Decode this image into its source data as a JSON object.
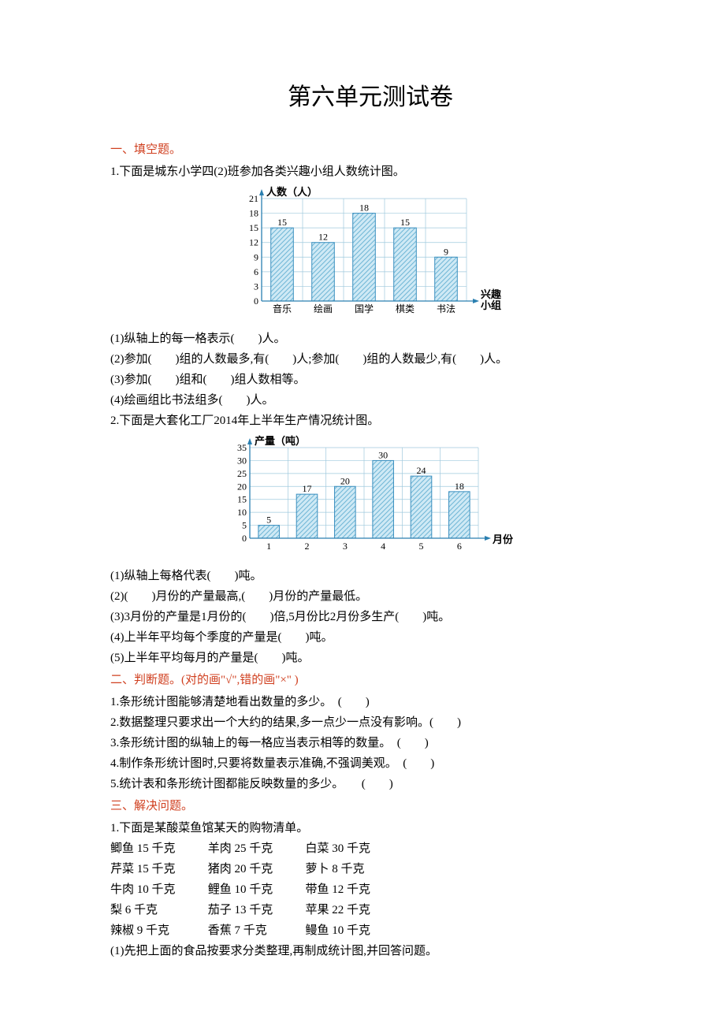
{
  "title": "第六单元测试卷",
  "sec1": {
    "head": "一、填空题。",
    "q1_intro": "1.下面是城东小学四(2)班参加各类兴趣小组人数统计图。",
    "q1_1": "(1)纵轴上的每一格表示(　　)人。",
    "q1_2": "(2)参加(　　)组的人数最多,有(　　)人;参加(　　)组的人数最少,有(　　)人。",
    "q1_3": "(3)参加(　　)组和(　　)组人数相等。",
    "q1_4": "(4)绘画组比书法组多(　　)人。",
    "q2_intro": "2.下面是大套化工厂2014年上半年生产情况统计图。",
    "q2_1": "(1)纵轴上每格代表(　　)吨。",
    "q2_2": "(2)(　　)月份的产量最高,(　　)月份的产量最低。",
    "q2_3": "(3)3月份的产量是1月份的(　　)倍,5月份比2月份多生产(　　)吨。",
    "q2_4": "(4)上半年平均每个季度的产量是(　　)吨。",
    "q2_5": "(5)上半年平均每月的产量是(　　)吨。"
  },
  "sec2": {
    "head": "二、判断题。(对的画\"√\",错的画\"×\" )",
    "j1": "1.条形统计图能够清楚地看出数量的多少。　(　　)",
    "j2": "2.数据整理只要求出一个大约的结果,多一点少一点没有影响。(　　)",
    "j3": "3.条形统计图的纵轴上的每一格应当表示相等的数量。　(　　)",
    "j4": "4.制作条形统计图时,只要将数量表示准确,不强调美观。　(　　)",
    "j5": "5.统计表和条形统计图都能反映数量的多少。　　(　　)"
  },
  "sec3": {
    "head": "三、解决问题。",
    "p1_intro": "1.下面是某酸菜鱼馆某天的购物清单。",
    "rows": [
      [
        "鲫鱼 15 千克",
        "羊肉 25 千克",
        "白菜 30 千克"
      ],
      [
        "芹菜 15 千克",
        "猪肉 20 千克",
        "萝卜 8 千克"
      ],
      [
        "牛肉 10 千克",
        "鲤鱼 10 千克",
        "带鱼 12 千克"
      ],
      [
        "梨 6 千克",
        "茄子 13 千克",
        "苹果 22 千克"
      ],
      [
        "辣椒 9 千克",
        "香蕉 7 千克",
        "鳗鱼 10 千克"
      ]
    ],
    "p1_sub": "(1)先把上面的食品按要求分类整理,再制成统计图,并回答问题。"
  },
  "chart_data": [
    {
      "type": "bar",
      "title": "",
      "ylabel": "人数（人）",
      "xlabel_lines": [
        "兴趣",
        "小组"
      ],
      "categories": [
        "音乐",
        "绘画",
        "国学",
        "棋类",
        "书法"
      ],
      "values": [
        15,
        12,
        18,
        15,
        9
      ],
      "yticks": [
        0,
        3,
        6,
        9,
        12,
        15,
        18,
        21
      ],
      "ylim": [
        0,
        21
      ]
    },
    {
      "type": "bar",
      "title": "",
      "ylabel": "产量（吨）",
      "xlabel_lines": [
        "月份"
      ],
      "categories": [
        "1",
        "2",
        "3",
        "4",
        "5",
        "6"
      ],
      "values": [
        5,
        17,
        20,
        30,
        24,
        18
      ],
      "yticks": [
        0,
        5,
        10,
        15,
        20,
        25,
        30,
        35
      ],
      "ylim": [
        0,
        35
      ]
    }
  ]
}
